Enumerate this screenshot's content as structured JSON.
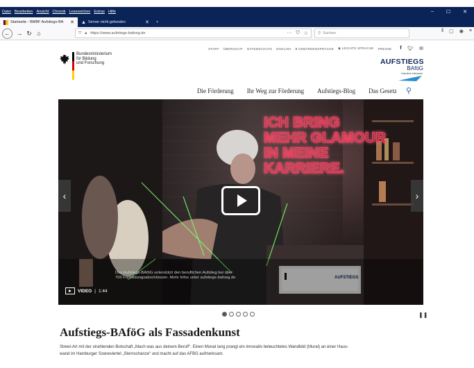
{
  "browser": {
    "menu": [
      "Datei",
      "Bearbeiten",
      "Ansicht",
      "Chronik",
      "Lesezeichen",
      "Extras",
      "Hilfe"
    ],
    "tabs": [
      {
        "label": "Startseite - BMBF Aufstiegs-BA"
      },
      {
        "label": "Server nicht gefunden"
      }
    ],
    "url": "https://www.aufstiegs-bafoeg.de",
    "search_placeholder": "Suchen"
  },
  "header": {
    "ministry_line1": "Bundesministerium",
    "ministry_line2": "für Bildung",
    "ministry_line3": "und Forschung",
    "util_links": [
      "START",
      "ÜBERSICHT",
      "DATENSCHUTZ",
      "ENGLISH",
      "GEBÄRDENSPRACHE",
      "LEICHTE SPRACHE",
      "PRESSE"
    ],
    "brand_line1": "AUFSTIEGS",
    "brand_line2": "BAföG",
    "brand_tagline": "Karriere inklusive."
  },
  "mainnav": {
    "items": [
      "Die Förderung",
      "Ihr Weg zur Förderung",
      "Aufstiegs-Blog",
      "Das Gesetz"
    ]
  },
  "hero": {
    "neon_lines": [
      "ICH BRING",
      "MEHR GLAMOUR",
      "IN MEINE",
      "KARRIERE."
    ],
    "overlay_line1": "Das Aufstiegs-BAföG unterstützt den beruflichen Aufstieg bei über",
    "overlay_line2": "700 Fortbildungsabschlüssen. Mehr Infos unter aufstiegs-bafoeg.de",
    "video_label": "VIDEO",
    "video_duration": "1:44",
    "slide_count": 5,
    "active_slide": 1
  },
  "article": {
    "title": "Aufstiegs-BAföG als Fassadenkunst",
    "body_line1": "Street-Art mit der strahlenden Botschaft „Mach was aus deinem Beruf!“. Einen Monat lang prangt ein innovativ beleuchtetes Wandbild (Mural) an einer Haus-",
    "body_line2": "wand im Hamburger Szeneviertel „Sternschanze“ und macht auf das AFBG aufmerksam."
  },
  "colors": {
    "chrome": "#0b2458",
    "neon": "#ff3a5c",
    "accent": "#2b59b6"
  }
}
